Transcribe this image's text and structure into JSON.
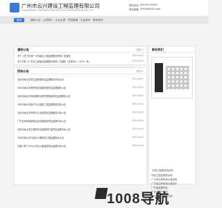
{
  "header": {
    "title": "广州市云兴建设工程监理有限公司",
    "subtitle": "GUANGZHOU YUNXING CONSTRUCTION SUPERVISION CO.,LTD",
    "hotline_label": "联系热线：",
    "hotline_value": "020-XXXXXXXX",
    "email_label": "联系邮箱：",
    "email_value": "XXXX@XXXX.com"
  },
  "nav": [
    "首页",
    "通知公告",
    "公司简介",
    "企业业绩",
    "项目管理",
    "行业资讯",
    "联系我们"
  ],
  "notice": {
    "title": "通知公告",
    "more": "更多>>",
    "rows": [
      {
        "t": "关于《关于印发广州市建设工程监理服务规范》的通知",
        "d": "2024-04-04"
      },
      {
        "t": "关于印发《广东省工程建设监理服务规范》的通知（粤发改价〔2022〕号）",
        "d": "2024-04-04"
      }
    ]
  },
  "news": {
    "title": "招标公告",
    "more": "更多>>",
    "rows": [
      {
        "t": "中标华南大学学生宿舍楼项目监理服务中标公告",
        "d": "2024-08-20"
      },
      {
        "t": "中标华南大学理学院实验楼改造项目监理服务公告",
        "d": "2024-08-10"
      },
      {
        "t": "中标华南大学粤港澳联合研究院新建项目监理服务公告",
        "d": "2024-08-10"
      },
      {
        "t": "中标华南大学医疗中心配套工程监理服务招标公告",
        "d": "2024-08-10"
      },
      {
        "t": "中标华南大学体育中心改造项目监理服务中标公告",
        "d": "2024-08-05"
      },
      {
        "t": "广东省海事局管辖区综合楼建设项目监理中标公告",
        "d": "2024-08-04"
      },
      {
        "t": "中标华南大学生物科学实验楼改扩建项目监理中标公告",
        "d": "2024-06-05"
      },
      {
        "t": "中标华南大学行政办公楼修缮工程监理招标公告",
        "d": "2024-06-05"
      },
      {
        "t": "中国人寿广州分公司办公楼装修项目监理中标公告",
        "d": "2024-06-05"
      }
    ]
  },
  "side": {
    "title": "联系我们",
    "items": [
      "中国工程建设信息网",
      "中国工程监理协会网",
      "广州市住房和城乡建设局",
      "广东省住房和城乡建设厅",
      "广东省监理协会",
      "广东监理行业网",
      "广州建设工程造价网"
    ]
  },
  "watermark": "1008导航"
}
